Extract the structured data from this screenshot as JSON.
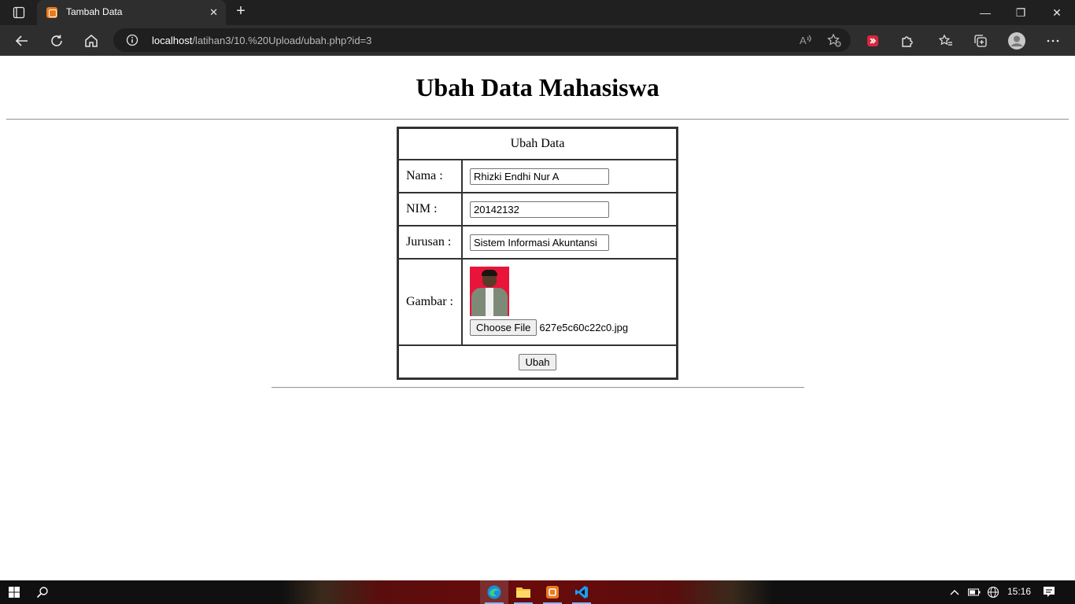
{
  "browser": {
    "tab_title": "Tambah Data",
    "tab_close": "✕",
    "new_tab": "+",
    "url_host": "localhost",
    "url_path": "/latihan3/10.%20Upload/ubah.php?id=3",
    "window_controls": {
      "minimize": "—",
      "restore": "❐",
      "close": "✕"
    }
  },
  "page": {
    "title": "Ubah Data Mahasiswa",
    "form": {
      "header": "Ubah Data",
      "fields": [
        {
          "label": "Nama :",
          "value": "Rhizki Endhi Nur A"
        },
        {
          "label": "NIM :",
          "value": "20142132"
        },
        {
          "label": "Jurusan :",
          "value": "Sistem Informasi Akuntansi"
        }
      ],
      "image_label": "Gambar :",
      "choose_file": "Choose File",
      "file_name": "627e5c60c22c0.jpg",
      "submit": "Ubah"
    }
  },
  "taskbar": {
    "time": "15:16",
    "apps": [
      "edge-icon",
      "file-explorer-icon",
      "xampp-icon",
      "vscode-icon"
    ]
  },
  "colors": {
    "accent": "#ea7a1e",
    "chrome_dark": "#202020",
    "toolbar": "#2e2e2e"
  }
}
